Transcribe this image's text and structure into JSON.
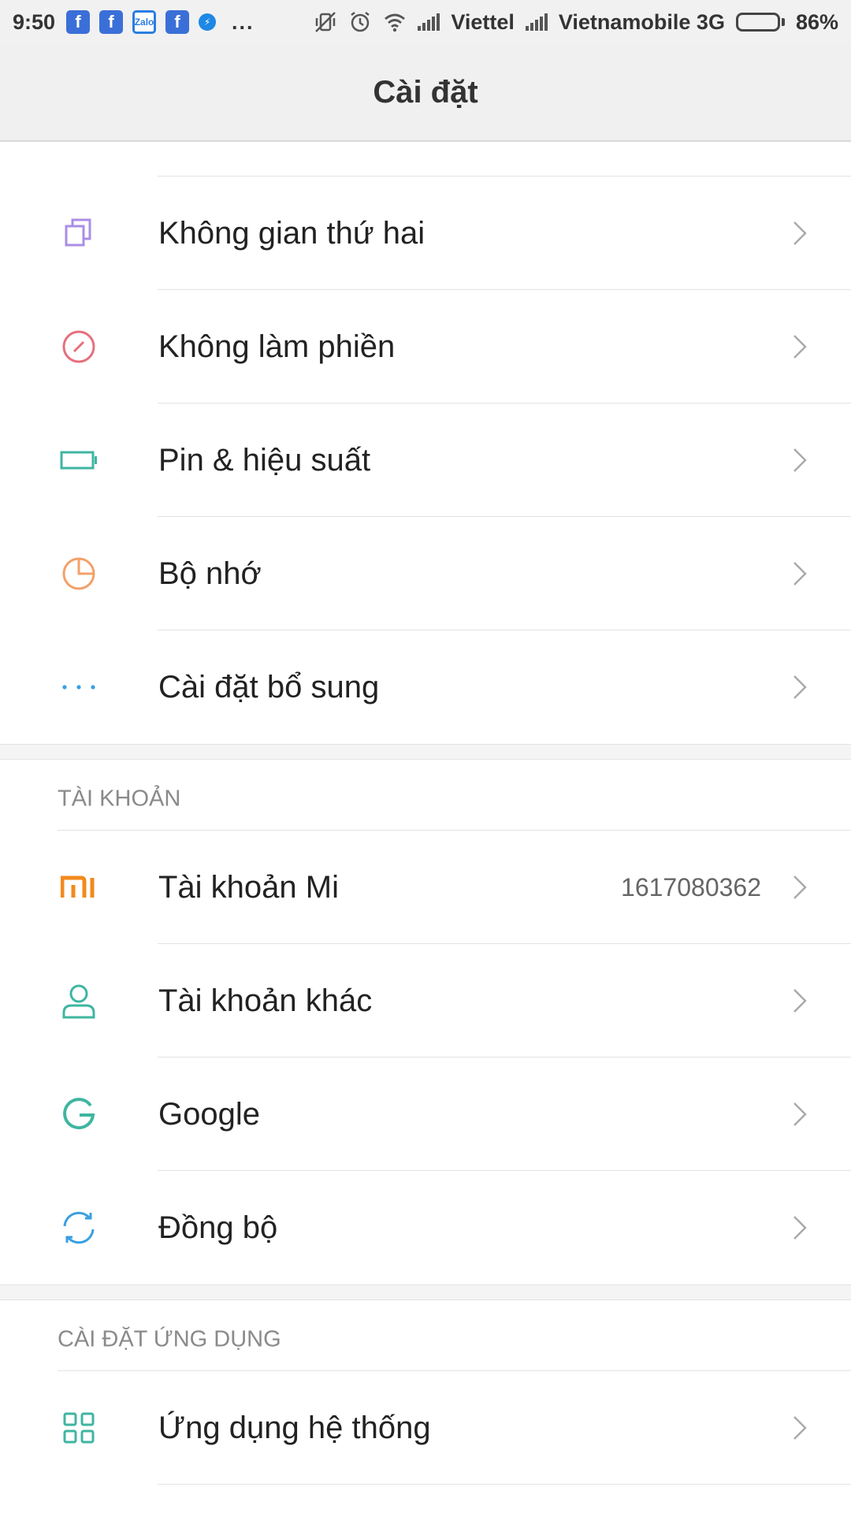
{
  "status_bar": {
    "time": "9:50",
    "notification_icons": [
      "facebook-icon",
      "facebook-icon",
      "zalo-icon",
      "facebook-icon",
      "messenger-icon"
    ],
    "zalo_label": "Zalo",
    "fb_label": "f",
    "more": "...",
    "carrier_1": "Viettel",
    "carrier_2": "Vietnamobile 3G",
    "battery_level": 86,
    "battery_text": "86%"
  },
  "header": {
    "title": "Cài đặt"
  },
  "groups": [
    {
      "items": [
        {
          "label": "Không gian thứ hai",
          "icon": "second-space-icon",
          "color": "#a98ee6"
        },
        {
          "label": "Không làm phiền",
          "icon": "do-not-disturb-icon",
          "color": "#e66f7d"
        },
        {
          "label": "Pin & hiệu suất",
          "icon": "battery-icon",
          "color": "#3fb5a1"
        },
        {
          "label": "Bộ nhớ",
          "icon": "storage-pie-icon",
          "color": "#f3a06a"
        },
        {
          "label": "Cài đặt bổ sung",
          "icon": "more-dots-icon",
          "color": "#3a9fe0"
        }
      ]
    }
  ],
  "accounts_section": {
    "header": "TÀI KHOẢN",
    "items": [
      {
        "label": "Tài khoản Mi",
        "value": "1617080362",
        "icon": "mi-logo-icon",
        "color": "#f28a1c"
      },
      {
        "label": "Tài khoản khác",
        "icon": "person-icon",
        "color": "#3fb5a1"
      },
      {
        "label": "Google",
        "icon": "google-g-icon",
        "color": "#3fb5a1"
      },
      {
        "label": "Đồng bộ",
        "icon": "sync-icon",
        "color": "#3a9fe0"
      }
    ]
  },
  "app_settings_section": {
    "header": "CÀI ĐẶT ỨNG DỤNG",
    "items": [
      {
        "label": "Ứng dụng hệ thống",
        "icon": "apps-grid-icon",
        "color": "#3fb5a1"
      }
    ]
  }
}
